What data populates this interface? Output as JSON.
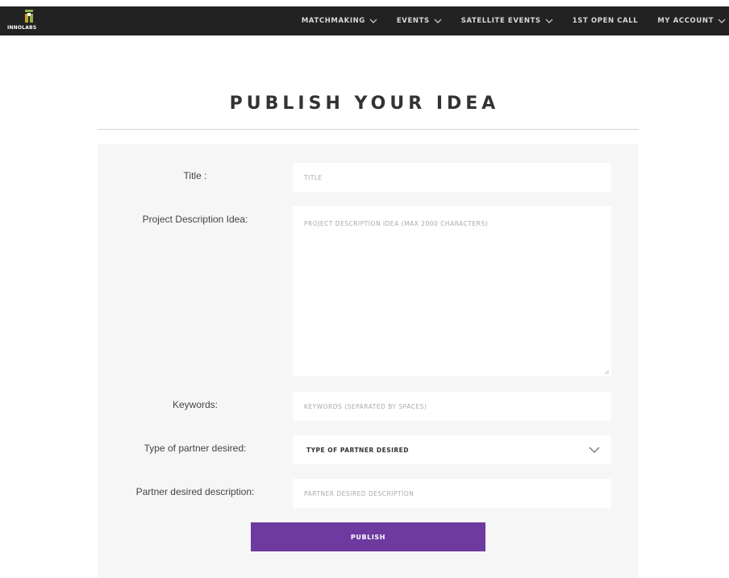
{
  "brand": {
    "logo_text": "INNOLABS"
  },
  "nav": {
    "items": [
      {
        "label": "MATCHMAKING",
        "dropdown": true
      },
      {
        "label": "EVENTS",
        "dropdown": true
      },
      {
        "label": "SATELLITE EVENTS",
        "dropdown": true
      },
      {
        "label": "1ST OPEN CALL",
        "dropdown": false
      },
      {
        "label": "MY ACCOUNT",
        "dropdown": true
      }
    ]
  },
  "page": {
    "title": "PUBLISH YOUR IDEA"
  },
  "form": {
    "title": {
      "label": "Title :",
      "placeholder": "TITLE"
    },
    "description": {
      "label": "Project Description Idea:",
      "placeholder": "PROJECT DESCRIPTION IDEA (MAX 2000 CHARACTERS)"
    },
    "keywords": {
      "label": "Keywords:",
      "placeholder": "KEYWORDS (SEPARATED BY SPACES)"
    },
    "partner_type": {
      "label": "Type of partner desired:",
      "selected": "TYPE OF PARTNER DESIRED"
    },
    "partner_description": {
      "label": "Partner desired description:",
      "placeholder": "PARTNER DESIRED DESCRIPTION"
    },
    "submit_label": "PUBLISH"
  },
  "colors": {
    "topbar": "#222222",
    "accent_button": "#6e3aa0",
    "panel": "#f6f6f6",
    "logo_green": "#8fb34a",
    "logo_gold": "#c9a227"
  },
  "icons": {
    "nav_dropdown": "chevron-down-icon",
    "select_dropdown": "chevron-down-icon",
    "resize": "resize-grip-icon"
  }
}
